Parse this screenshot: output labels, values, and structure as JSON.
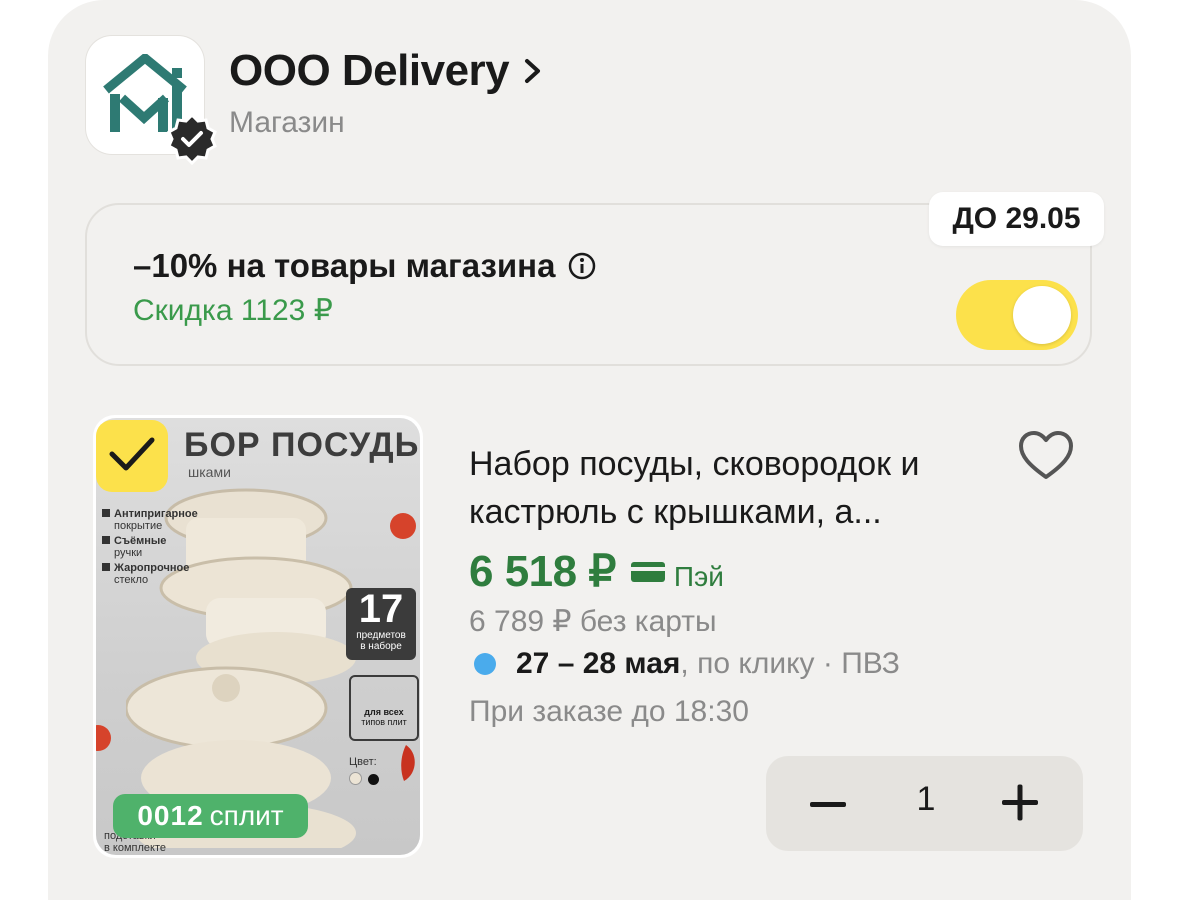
{
  "shop": {
    "name": "ООО Delivery",
    "type": "Магазин",
    "logo_icon": "store-logo-house-m",
    "verified_icon": "verified-badge-icon"
  },
  "promo": {
    "title": "–10% на товары магазина",
    "discount": "Скидка 1123 ₽",
    "deadline": "ДО 29.05",
    "toggle_on": true,
    "accent": "#fce14b"
  },
  "product": {
    "selected": true,
    "image": {
      "title": "БОР ПОСУДЫ",
      "subtitle": "шками",
      "features": [
        {
          "bold": "Антипригарное",
          "rest": "покрытие"
        },
        {
          "bold": "Съёмные",
          "rest": "ручки"
        },
        {
          "bold": "Жаропрочное",
          "rest": "стекло"
        }
      ],
      "count": "17",
      "count_caption_1": "предметов",
      "count_caption_2": "в наборе",
      "plates_caption_1": "для всех",
      "plates_caption_2": "типов плит",
      "color_label": "Цвет:",
      "bottom_1": "подставки",
      "bottom_2": "в комплекте"
    },
    "split": {
      "amount": "0012",
      "label": "сплит"
    },
    "title": "Набор посуды, сковородок и кастрюль с крышками, а...",
    "price": "6 518 ₽",
    "pay_label": "Пэй",
    "old_price": "6 789 ₽  без карты",
    "delivery_dates": "27 – 28 мая",
    "delivery_rest": ", по клику · ПВЗ",
    "order_by": "При заказе до 18:30",
    "quantity": "1",
    "price_color": "#2f7d3e"
  }
}
